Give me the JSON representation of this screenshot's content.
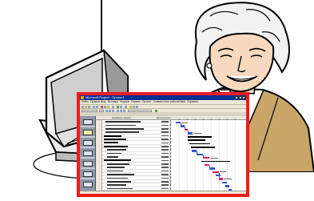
{
  "window": {
    "title": "Microsoft Project - Проект1",
    "controls": [
      "minimize",
      "maximize",
      "close"
    ]
  },
  "menu": [
    "Файл",
    "Правка",
    "Вид",
    "Вставка",
    "Формат",
    "Сервис",
    "Проект",
    "Совместная работа",
    "Окно",
    "Справка"
  ],
  "grid_header": {
    "col_name": "Название задачи",
    "col_duration": "Длительность"
  },
  "icons": {
    "app": "project-icon",
    "computer": "desktop-computer-illustration",
    "person": "woman-portrait-illustration"
  },
  "colors": {
    "frame_border": "#ee1c1c",
    "titlebar": "#0b2f8f",
    "task_bar": "#3355cc",
    "critical_bar": "#e21b6c",
    "view_bar": "#8f99a8"
  }
}
